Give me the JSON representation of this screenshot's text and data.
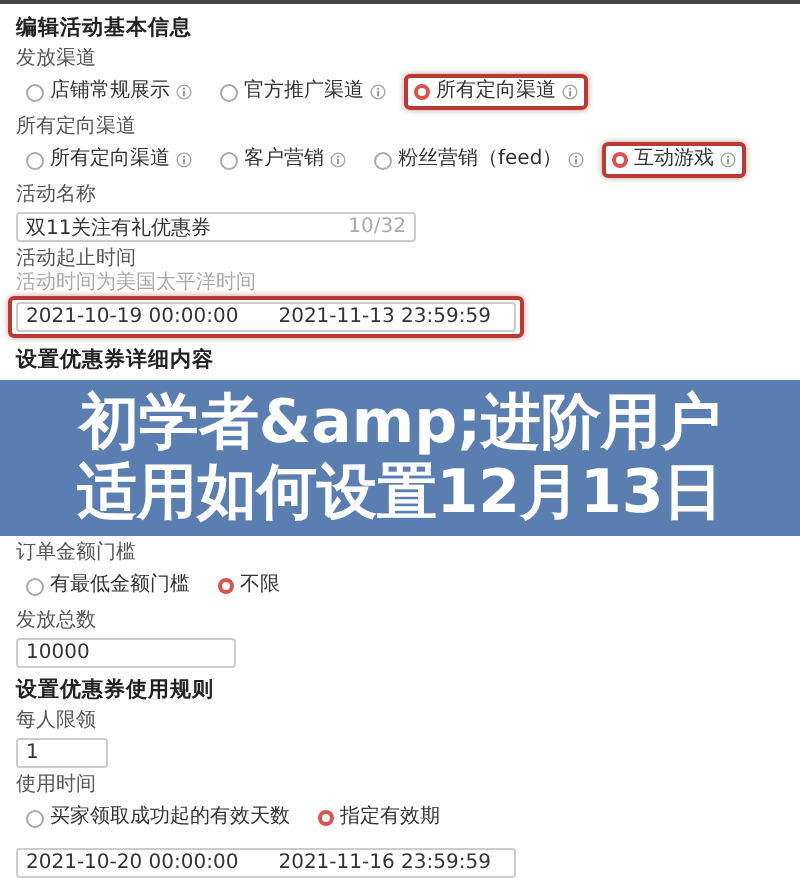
{
  "blocks": [
    {
      "kind": "heading",
      "text": "编辑活动基本信息"
    },
    {
      "kind": "radio",
      "label": "发放渠道",
      "options": [
        {
          "label": "店铺常规展示",
          "selected": false,
          "highlighted": false,
          "info": true
        },
        {
          "label": "官方推广渠道",
          "selected": false,
          "highlighted": false,
          "info": true
        },
        {
          "label": "所有定向渠道",
          "selected": true,
          "highlighted": true,
          "info": true
        }
      ]
    },
    {
      "kind": "radio",
      "label": "所有定向渠道",
      "options": [
        {
          "label": "所有定向渠道",
          "selected": false,
          "highlighted": false,
          "info": true
        },
        {
          "label": "客户营销",
          "selected": false,
          "highlighted": false,
          "info": true
        },
        {
          "label": "粉丝营销（feed）",
          "selected": false,
          "highlighted": false,
          "info": true
        },
        {
          "label": "互动游戏",
          "selected": true,
          "highlighted": true,
          "info": true
        }
      ]
    },
    {
      "kind": "text",
      "label": "活动名称",
      "value": "双11关注有礼优惠券",
      "counter": "10/32"
    },
    {
      "kind": "daterange",
      "label": "活动起止时间",
      "hint": "活动时间为美国太平洋时间",
      "start": "2021-10-19 00:00:00",
      "end": "2021-11-13 23:59:59",
      "highlighted": true
    },
    {
      "kind": "heading",
      "text": "设置优惠券详细内容"
    },
    {
      "kind": "banner",
      "lines": [
        "初学者&amp;进阶用户",
        "适用如何设置12月13日"
      ]
    },
    {
      "kind": "radio",
      "label": "订单金额门槛",
      "options": [
        {
          "label": "有最低金额门槛",
          "selected": false,
          "highlighted": false,
          "info": false
        },
        {
          "label": "不限",
          "selected": true,
          "highlighted": false,
          "info": false
        }
      ]
    },
    {
      "kind": "text",
      "label": "发放总数",
      "value": "10000"
    },
    {
      "kind": "heading",
      "text": "设置优惠券使用规则"
    },
    {
      "kind": "text",
      "label": "每人限领",
      "value": "1"
    },
    {
      "kind": "radio",
      "label": "使用时间",
      "options": [
        {
          "label": "买家领取成功起的有效天数",
          "selected": false,
          "highlighted": false,
          "info": false
        },
        {
          "label": "指定有效期",
          "selected": true,
          "highlighted": false,
          "info": false
        }
      ]
    },
    {
      "kind": "daterange",
      "start": "2021-10-20 00:00:00",
      "end": "2021-11-16 23:59:59",
      "highlighted": false
    }
  ]
}
